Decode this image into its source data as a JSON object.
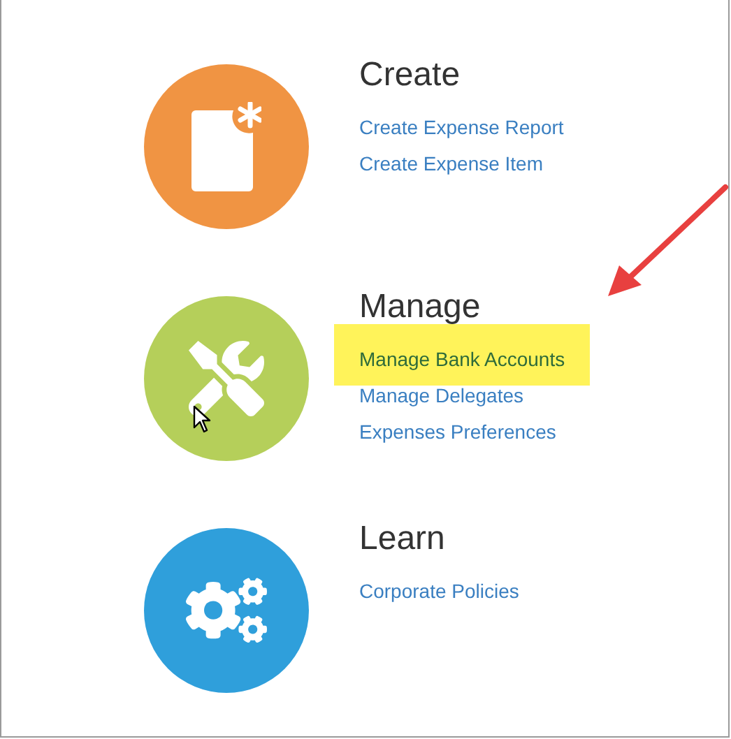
{
  "sections": [
    {
      "title": "Create",
      "kind": "document",
      "color": "#f09443",
      "links": [
        {
          "label": "Create Expense Report",
          "highlighted": false
        },
        {
          "label": "Create Expense Item",
          "highlighted": false
        }
      ]
    },
    {
      "title": "Manage",
      "kind": "tools",
      "color": "#b5cf5a",
      "links": [
        {
          "label": "Manage Bank Accounts",
          "highlighted": true
        },
        {
          "label": "Manage Delegates",
          "highlighted": false
        },
        {
          "label": "Expenses Preferences",
          "highlighted": false
        }
      ]
    },
    {
      "title": "Learn",
      "kind": "gears",
      "color": "#2f9fdb",
      "links": [
        {
          "label": "Corporate Policies",
          "highlighted": false
        }
      ]
    }
  ]
}
